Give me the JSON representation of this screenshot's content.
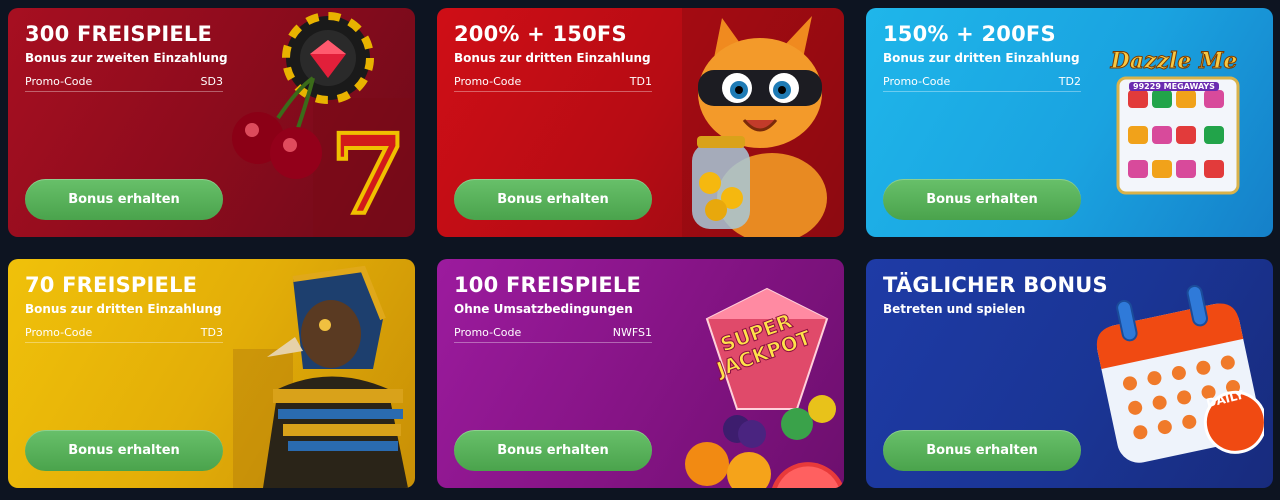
{
  "cards": [
    {
      "title": "300 FREISPIELE",
      "subtitle": "Bonus zur zweiten Einzahlung",
      "promo_label": "Promo-Code",
      "promo_code": "SD3",
      "button_label": "Bonus erhalten",
      "art_icon": "casino-chip-cherries-seven-icon"
    },
    {
      "title": "200% + 150FS",
      "subtitle": "Bonus zur dritten Einzahlung",
      "promo_label": "Promo-Code",
      "promo_code": "TD1",
      "button_label": "Bonus erhalten",
      "art_icon": "masked-cat-with-coin-jar-icon"
    },
    {
      "title": "150% + 200FS",
      "subtitle": "Bonus zur dritten Einzahlung",
      "promo_label": "Promo-Code",
      "promo_code": "TD2",
      "button_label": "Bonus erhalten",
      "art_icon": "slot-machine-icon",
      "art_logo": "Dazzle Me",
      "art_logo_sub": "99229 MEGAWAYS"
    },
    {
      "title": "70 FREISPIELE",
      "subtitle": "Bonus zur dritten Einzahlung",
      "promo_label": "Promo-Code",
      "promo_code": "TD3",
      "button_label": "Bonus erhalten",
      "art_icon": "egyptian-falcon-god-icon"
    },
    {
      "title": "100 FREISPIELE",
      "subtitle": "Ohne Umsatzbedingungen",
      "promo_label": "Promo-Code",
      "promo_code": "NWFS1",
      "button_label": "Bonus erhalten",
      "art_icon": "super-jackpot-fruits-icon",
      "art_text": "SUPER JACKPOT"
    },
    {
      "title": "TÄGLICHER BONUS",
      "subtitle": "Betreten und spielen",
      "button_label": "Bonus erhalten",
      "art_icon": "calendar-icon",
      "art_badge": "DAILY"
    }
  ],
  "colors": {
    "page_bg": "#0d1421",
    "button_green": "#5cb85c",
    "card1": "#a70f21",
    "card2": "#cf0e16",
    "card3": "#1fb6ea",
    "card4": "#f0c10a",
    "card5": "#9c1b9e",
    "card6": "#1e3ba6"
  }
}
